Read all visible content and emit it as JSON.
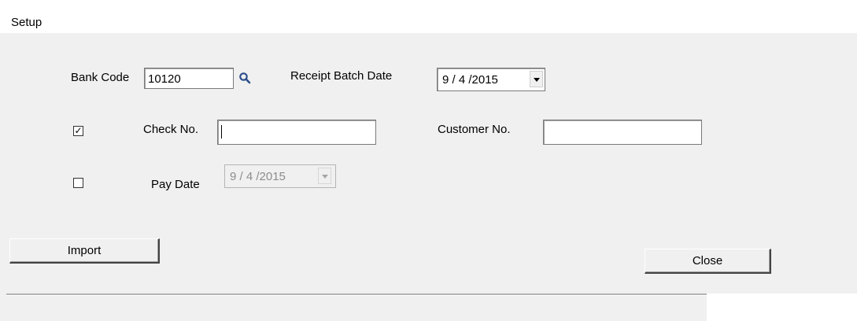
{
  "window": {
    "title": "Setup"
  },
  "bank_code": {
    "label": "Bank Code",
    "value": "10120"
  },
  "receipt_batch_date": {
    "label": "Receipt Batch Date",
    "value": "9 / 4 /2015"
  },
  "check_no": {
    "checked": true,
    "check_mark": "✓",
    "label": "Check No.",
    "value": ""
  },
  "customer_no": {
    "label": "Customer No.",
    "value": ""
  },
  "pay_date": {
    "checked": false,
    "label": "Pay Date",
    "value": "9 / 4 /2015",
    "enabled": false
  },
  "buttons": {
    "import_label": "Import",
    "close_label": "Close"
  },
  "icons": {
    "lookup": "search-icon",
    "dropdown": "chevron-down-icon"
  },
  "colors": {
    "panel_bg": "#f0f0f0",
    "search_icon": "#2b4f8c"
  }
}
